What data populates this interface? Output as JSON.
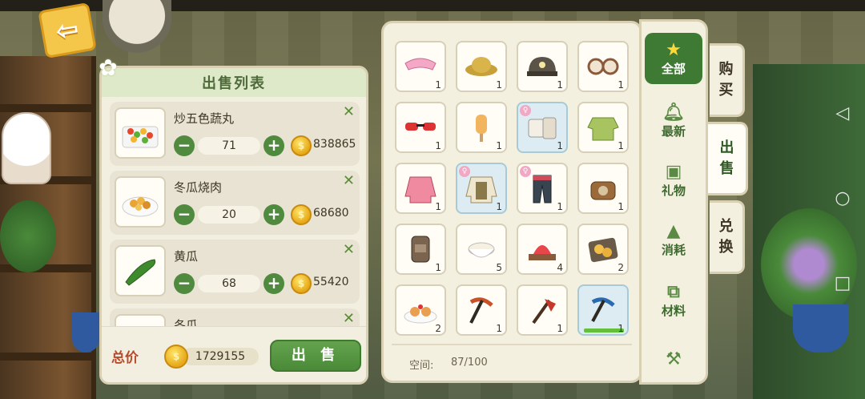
{
  "sell_panel": {
    "title": "出售列表",
    "items": [
      {
        "name": "炒五色蔬丸",
        "quantity": "71",
        "price": "838865",
        "icon": "veggie-skewer-icon"
      },
      {
        "name": "冬瓜烧肉",
        "quantity": "20",
        "price": "68680",
        "icon": "braised-pork-icon"
      },
      {
        "name": "黄瓜",
        "quantity": "68",
        "price": "55420",
        "icon": "cucumber-icon"
      },
      {
        "name": "冬瓜",
        "quantity": "",
        "price": "",
        "icon": "winter-melon-icon"
      }
    ],
    "minus": "−",
    "plus": "+",
    "remove": "✕",
    "total_label": "总价",
    "total_value": "1729155",
    "sell_button": "出 售"
  },
  "inventory": {
    "space_label": "空间:",
    "space_value": "87/100",
    "slots": [
      {
        "icon": "pink-visor-icon",
        "count": "1"
      },
      {
        "icon": "straw-hat-icon",
        "count": "1"
      },
      {
        "icon": "miner-helmet-icon",
        "count": "1"
      },
      {
        "icon": "goggles-icon",
        "count": "1"
      },
      {
        "icon": "sunglasses-icon",
        "count": "1"
      },
      {
        "icon": "popsicle-icon",
        "count": "1"
      },
      {
        "icon": "outfit-set-icon",
        "count": "1"
      },
      {
        "icon": "green-jacket-icon",
        "count": "1"
      },
      {
        "icon": "pink-jacket-icon",
        "count": "1"
      },
      {
        "icon": "khaki-vest-icon",
        "count": "1"
      },
      {
        "icon": "pants-icon",
        "count": "1"
      },
      {
        "icon": "leather-bag-icon",
        "count": "1"
      },
      {
        "icon": "backpack-icon",
        "count": "1"
      },
      {
        "icon": "milk-bowl-icon",
        "count": "5"
      },
      {
        "icon": "shaved-ice-icon",
        "count": "4"
      },
      {
        "icon": "cookie-plate-icon",
        "count": "2"
      },
      {
        "icon": "cupcake-plate-icon",
        "count": "2"
      },
      {
        "icon": "pickaxe-icon",
        "count": "1"
      },
      {
        "icon": "axe-icon",
        "count": "1"
      },
      {
        "icon": "blue-pickaxe-icon",
        "count": "1"
      }
    ]
  },
  "categories": [
    {
      "label": "全部",
      "icon": "star-icon"
    },
    {
      "label": "最新",
      "icon": "bell-icon"
    },
    {
      "label": "礼物",
      "icon": "gift-icon"
    },
    {
      "label": "消耗",
      "icon": "riceball-icon"
    },
    {
      "label": "材料",
      "icon": "scroll-icon"
    },
    {
      "label": "",
      "icon": "shovel-icon"
    }
  ],
  "tabs": [
    {
      "label": "购\n买"
    },
    {
      "label": "出\n售"
    },
    {
      "label": "兑\n换"
    }
  ],
  "colors": {
    "accent_green": "#4f8a3e",
    "panel_bg": "#f3efe0",
    "coin_gold": "#e6a817"
  }
}
